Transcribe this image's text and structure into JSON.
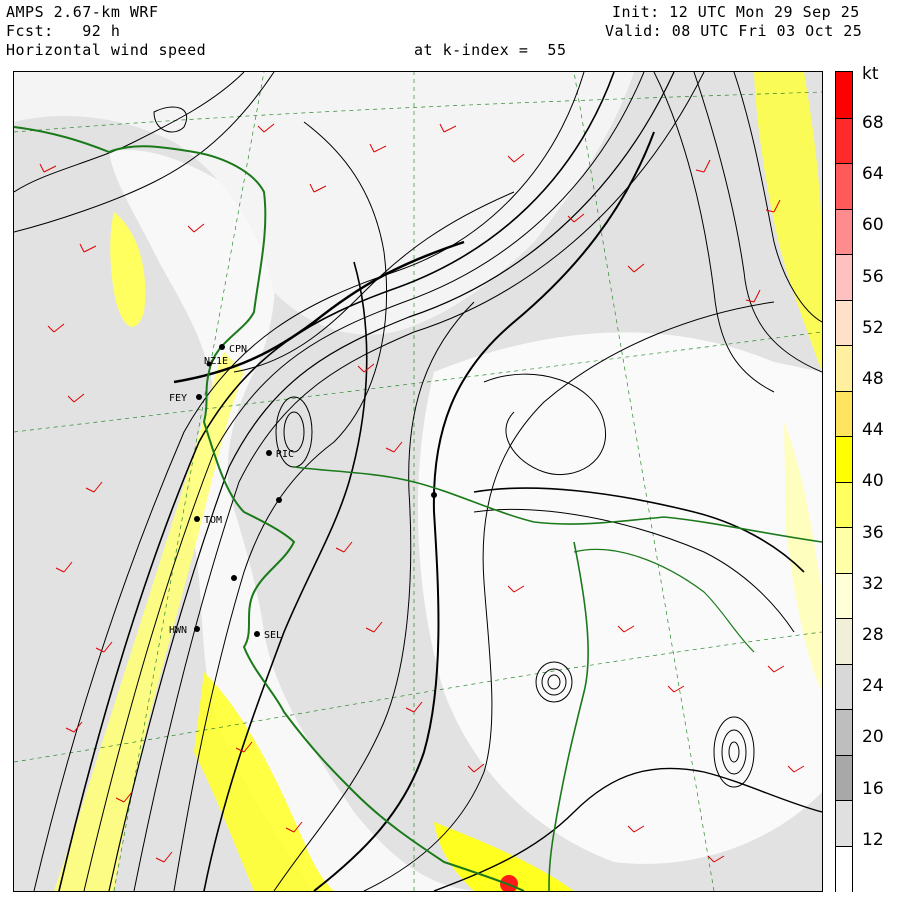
{
  "header": {
    "model": "AMPS 2.67-km WRF",
    "forecast": "Fcst:   92 h",
    "field": "Horizontal wind speed",
    "level": "at k-index =  55",
    "init": "Init: 12 UTC Mon 29 Sep 25",
    "valid": "Valid: 08 UTC Fri 03 Oct 25"
  },
  "colorbar": {
    "unit": "kt",
    "labels": [
      "68",
      "64",
      "60",
      "56",
      "52",
      "48",
      "44",
      "40",
      "36",
      "32",
      "28",
      "24",
      "20",
      "16",
      "12"
    ],
    "colors": [
      "#ff0000",
      "#ff2b2b",
      "#ff5a5a",
      "#ff8c8c",
      "#ffc0c0",
      "#ffe0c8",
      "#fff0a0",
      "#ffe460",
      "#ffff00",
      "#ffff60",
      "#ffffa8",
      "#ffffd8",
      "#f0f0d8",
      "#d8d8d8",
      "#bebebe",
      "#a8a8a8",
      "#e0e0e0",
      "#ffffff"
    ]
  },
  "stations": [
    {
      "code": "CPN"
    },
    {
      "code": "NZ1E"
    },
    {
      "code": "FEY"
    },
    {
      "code": "RIC"
    },
    {
      "code": "TOM"
    },
    {
      "code": "HWN"
    },
    {
      "code": "SEL"
    }
  ],
  "legend_colors": {
    "coastline": "#1a7a1a",
    "barbs": "#e00000",
    "streamlines": "#000000",
    "grid": "#2a8a2a"
  }
}
